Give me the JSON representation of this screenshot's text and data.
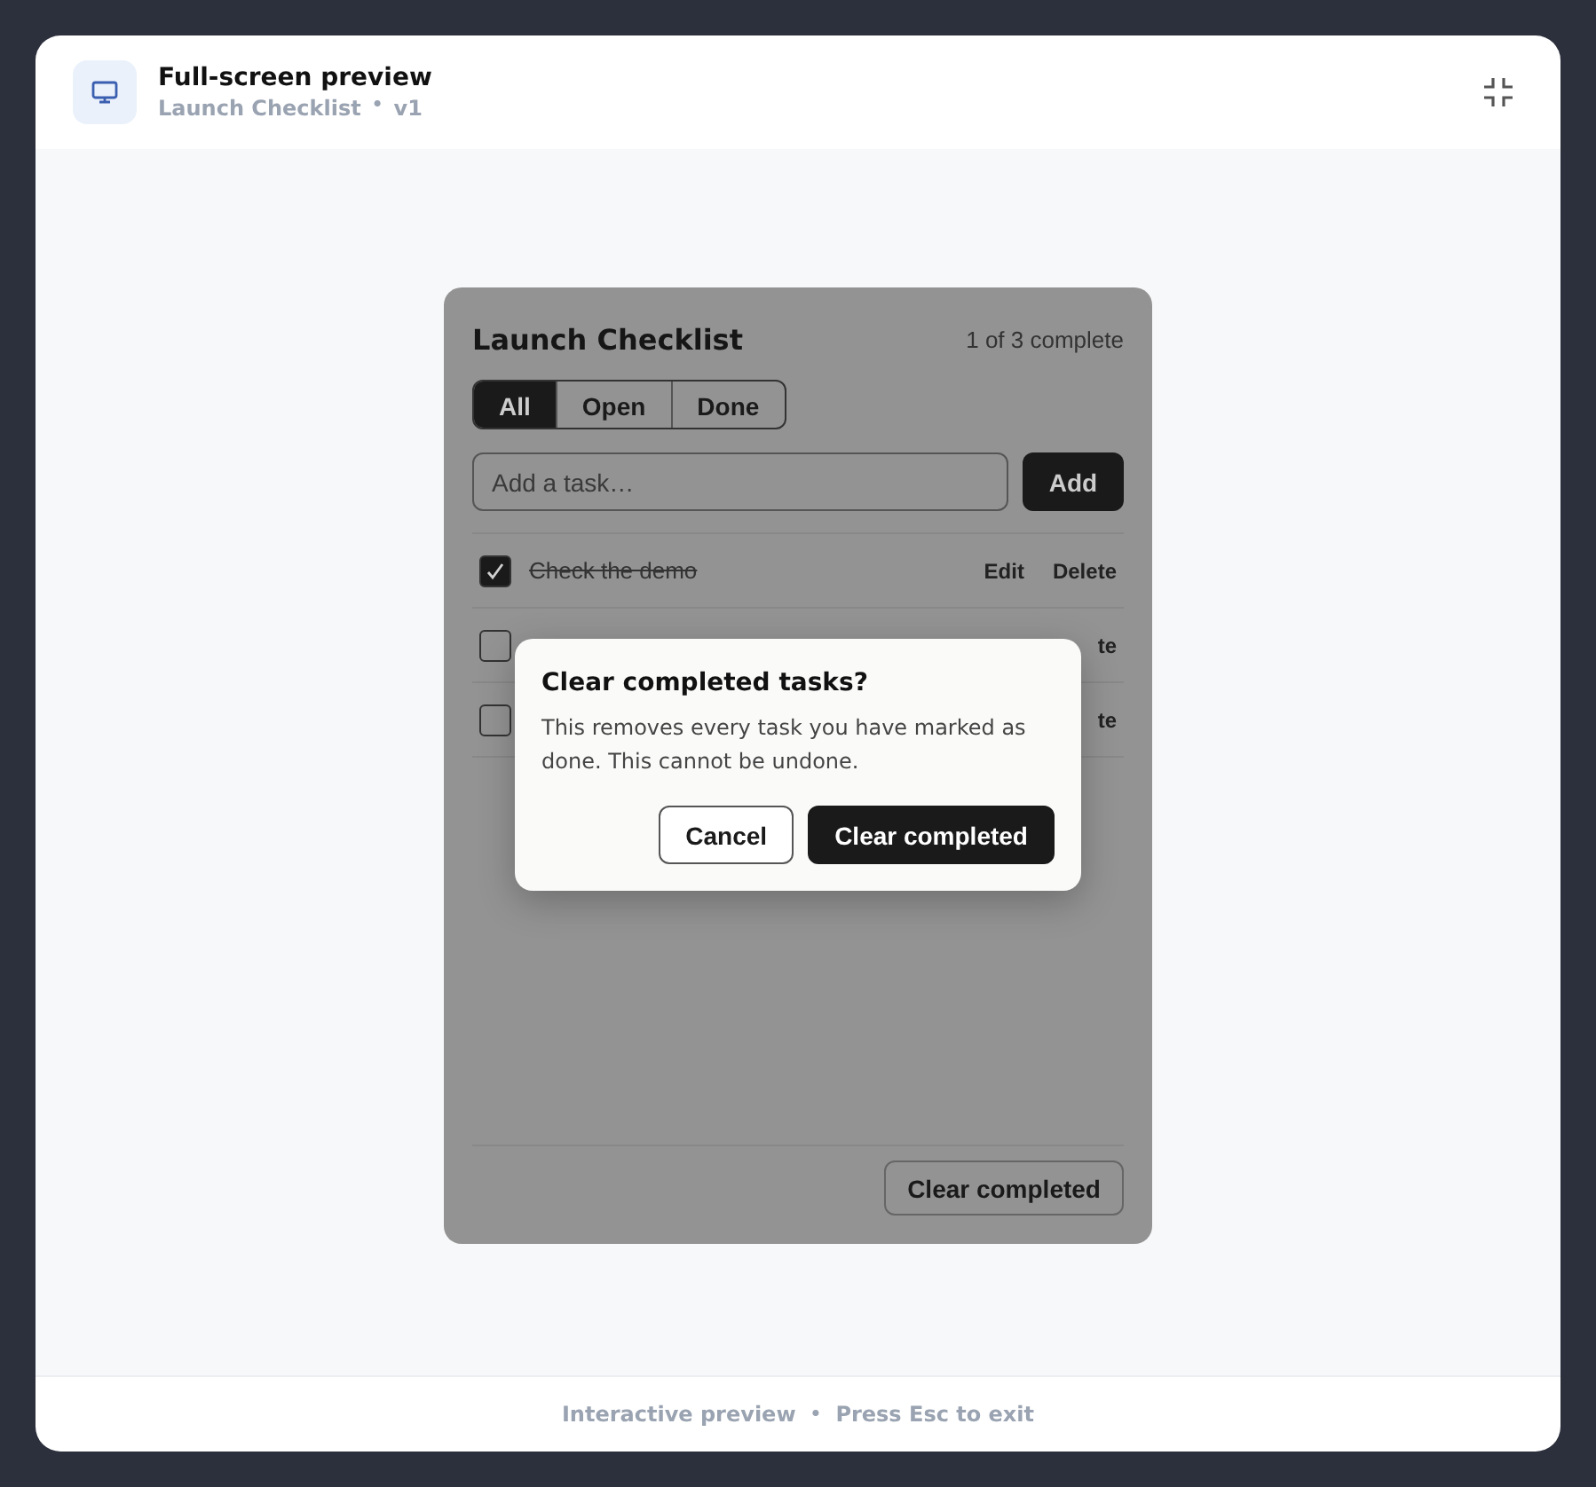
{
  "header": {
    "title": "Full-screen preview",
    "subtitle": "Launch Checklist",
    "separator": "•",
    "version": "v1"
  },
  "app": {
    "title": "Launch Checklist",
    "progress": "1 of 3 complete",
    "filters": [
      {
        "label": "All",
        "selected": true
      },
      {
        "label": "Open",
        "selected": false
      },
      {
        "label": "Done",
        "selected": false
      }
    ],
    "new_task": {
      "placeholder": "Add a task…",
      "button": "Add"
    },
    "tasks": [
      {
        "label": "Check the demo",
        "checked": true,
        "actions": [
          "Edit",
          "Delete"
        ]
      },
      {
        "checked": false,
        "actions": [
          "te"
        ]
      },
      {
        "checked": false,
        "actions": [
          "te"
        ]
      }
    ],
    "footer_button": "Clear completed"
  },
  "dialog": {
    "title": "Clear completed tasks?",
    "message": "This removes every task you have marked as done. This cannot be undone.",
    "buttons": [
      {
        "label": "Cancel",
        "kind": "secondary"
      },
      {
        "label": "Clear completed",
        "kind": "primary"
      }
    ]
  },
  "footer": {
    "hint": "Interactive preview",
    "separator": "•",
    "shortcut": "Press Esc to exit"
  }
}
